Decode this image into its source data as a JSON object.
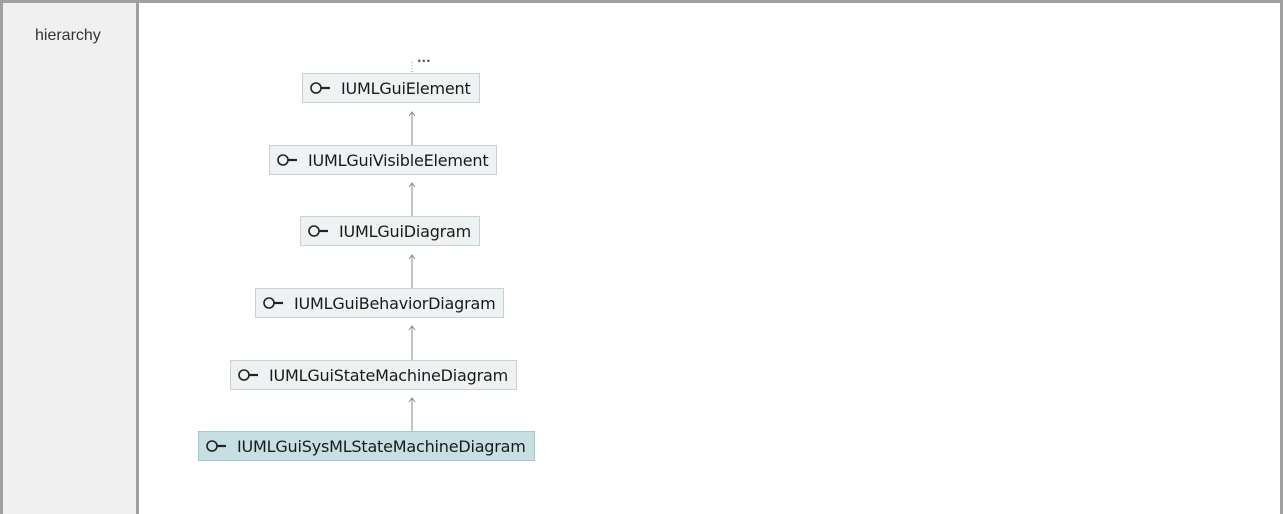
{
  "row_label": "hierarchy",
  "more_indicator": "...",
  "hierarchy": [
    {
      "name": "IUMLGuiElement",
      "icon": "interface-icon"
    },
    {
      "name": "IUMLGuiVisibleElement",
      "icon": "interface-icon"
    },
    {
      "name": "IUMLGuiDiagram",
      "icon": "interface-icon"
    },
    {
      "name": "IUMLGuiBehaviorDiagram",
      "icon": "interface-icon"
    },
    {
      "name": "IUMLGuiStateMachineDiagram",
      "icon": "interface-icon"
    },
    {
      "name": "IUMLGuiSysMLStateMachineDiagram",
      "icon": "interface-icon",
      "current": true
    }
  ],
  "colors": {
    "node_background": "#eef2f3",
    "current_node_background": "#c5dfe3",
    "frame_border": "#a0a0a0",
    "label_background": "#f0f0f0"
  }
}
